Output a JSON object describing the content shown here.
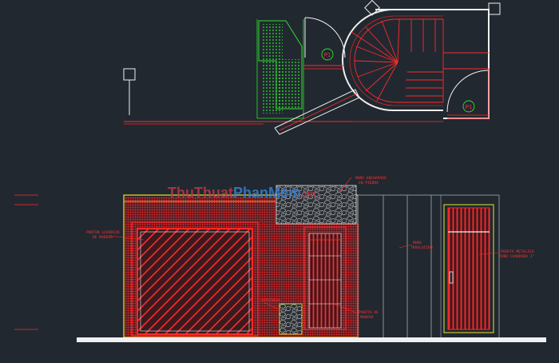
{
  "plan": {
    "door_tags": [
      "P1",
      "P1"
    ]
  },
  "elevation": {
    "annotations": {
      "stone_wall": [
        "MURO ENCHAPADO",
        "EN PIEDRA"
      ],
      "garage_door": [
        "PORTON LEVADIZO",
        "DE MADERA"
      ],
      "wood_door": [
        "PUERTA DE",
        "MADERA"
      ],
      "metal_door": [
        "PUERTA METALICA",
        "TUBO CUADRADO 1\""
      ],
      "glass_wall": [
        "MURO",
        "TRASLUCIDO"
      ],
      "planter": "JARDINERA"
    }
  },
  "watermark": {
    "part1": "ThuThuat",
    "part2": "PhanMem",
    "part3": ".vn"
  },
  "colors": {
    "background": "#212830",
    "red": "#ff2a2a",
    "green": "#2ee02e",
    "yellow": "#e6e62e",
    "white": "#f0f0f0",
    "grey": "#8a8f96"
  }
}
